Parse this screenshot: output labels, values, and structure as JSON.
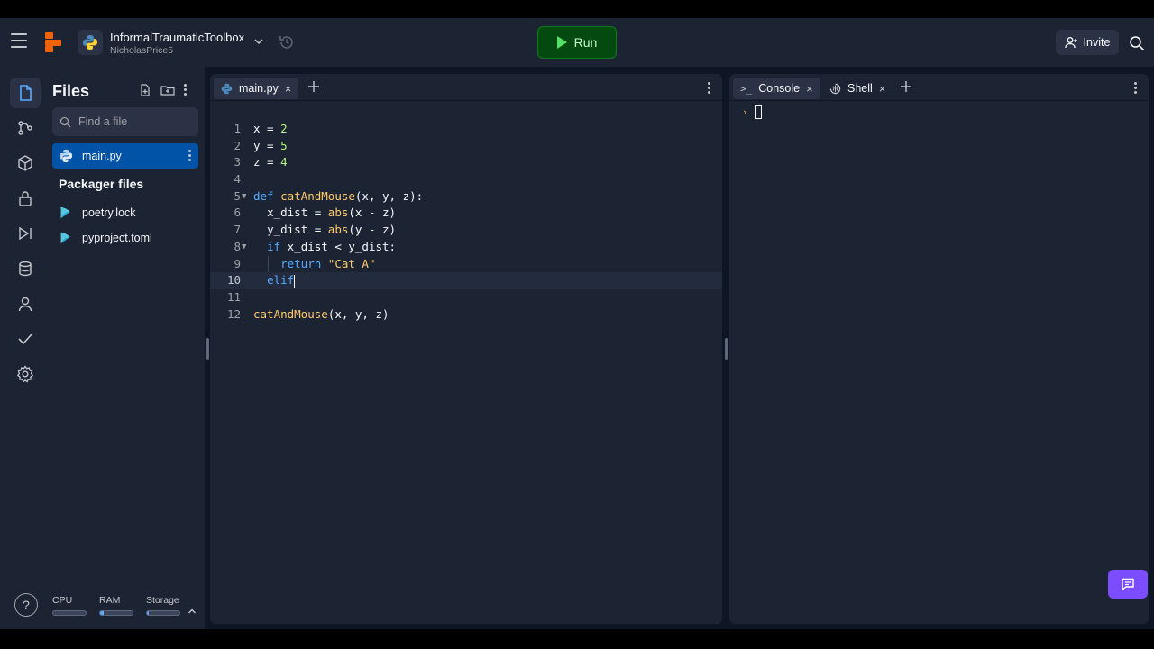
{
  "project": {
    "name": "InformalTraumaticToolbox",
    "owner": "NicholasPrice5"
  },
  "header": {
    "run_label": "Run",
    "invite_label": "Invite"
  },
  "files": {
    "title": "Files",
    "search_placeholder": "Find a file",
    "items": [
      {
        "name": "main.py",
        "selected": true
      }
    ],
    "packager_title": "Packager files",
    "packager_items": [
      {
        "name": "poetry.lock"
      },
      {
        "name": "pyproject.toml"
      }
    ]
  },
  "resources": [
    {
      "label": "CPU",
      "usage": 0.0
    },
    {
      "label": "RAM",
      "usage": 0.12
    },
    {
      "label": "Storage",
      "usage": 0.05
    }
  ],
  "editor": {
    "tab": "main.py",
    "current_line": 10,
    "line_numbers": [
      "1",
      "2",
      "3",
      "4",
      "5",
      "6",
      "7",
      "8",
      "9",
      "10",
      "11",
      "12"
    ],
    "code": {
      "l1_a": "x",
      "l1_b": " = ",
      "l1_c": "2",
      "l2_a": "y",
      "l2_b": " = ",
      "l2_c": "5",
      "l3_a": "z",
      "l3_b": " = ",
      "l3_c": "4",
      "l5_kw": "def",
      "l5_fn": "catAndMouse",
      "l5_rest": "(x, y, z):",
      "l6_a": "x_dist = ",
      "l6_bi": "abs",
      "l6_b": "(x - z)",
      "l7_a": "y_dist = ",
      "l7_bi": "abs",
      "l7_b": "(y - z)",
      "l8_kw": "if",
      "l8_rest": " x_dist < y_dist:",
      "l9_kw": "return",
      "l9_str": "\"Cat A\"",
      "l10_kw": "elif",
      "l12_fn": "catAndMouse",
      "l12_rest": "(x, y, z)"
    }
  },
  "console": {
    "tabs": [
      "Console",
      "Shell"
    ],
    "prompt": "›"
  },
  "colors": {
    "background": "#0e1525",
    "panel": "#1c2333",
    "accent": "#0053a6",
    "run": "#044a10",
    "chat": "#7c4dff"
  }
}
